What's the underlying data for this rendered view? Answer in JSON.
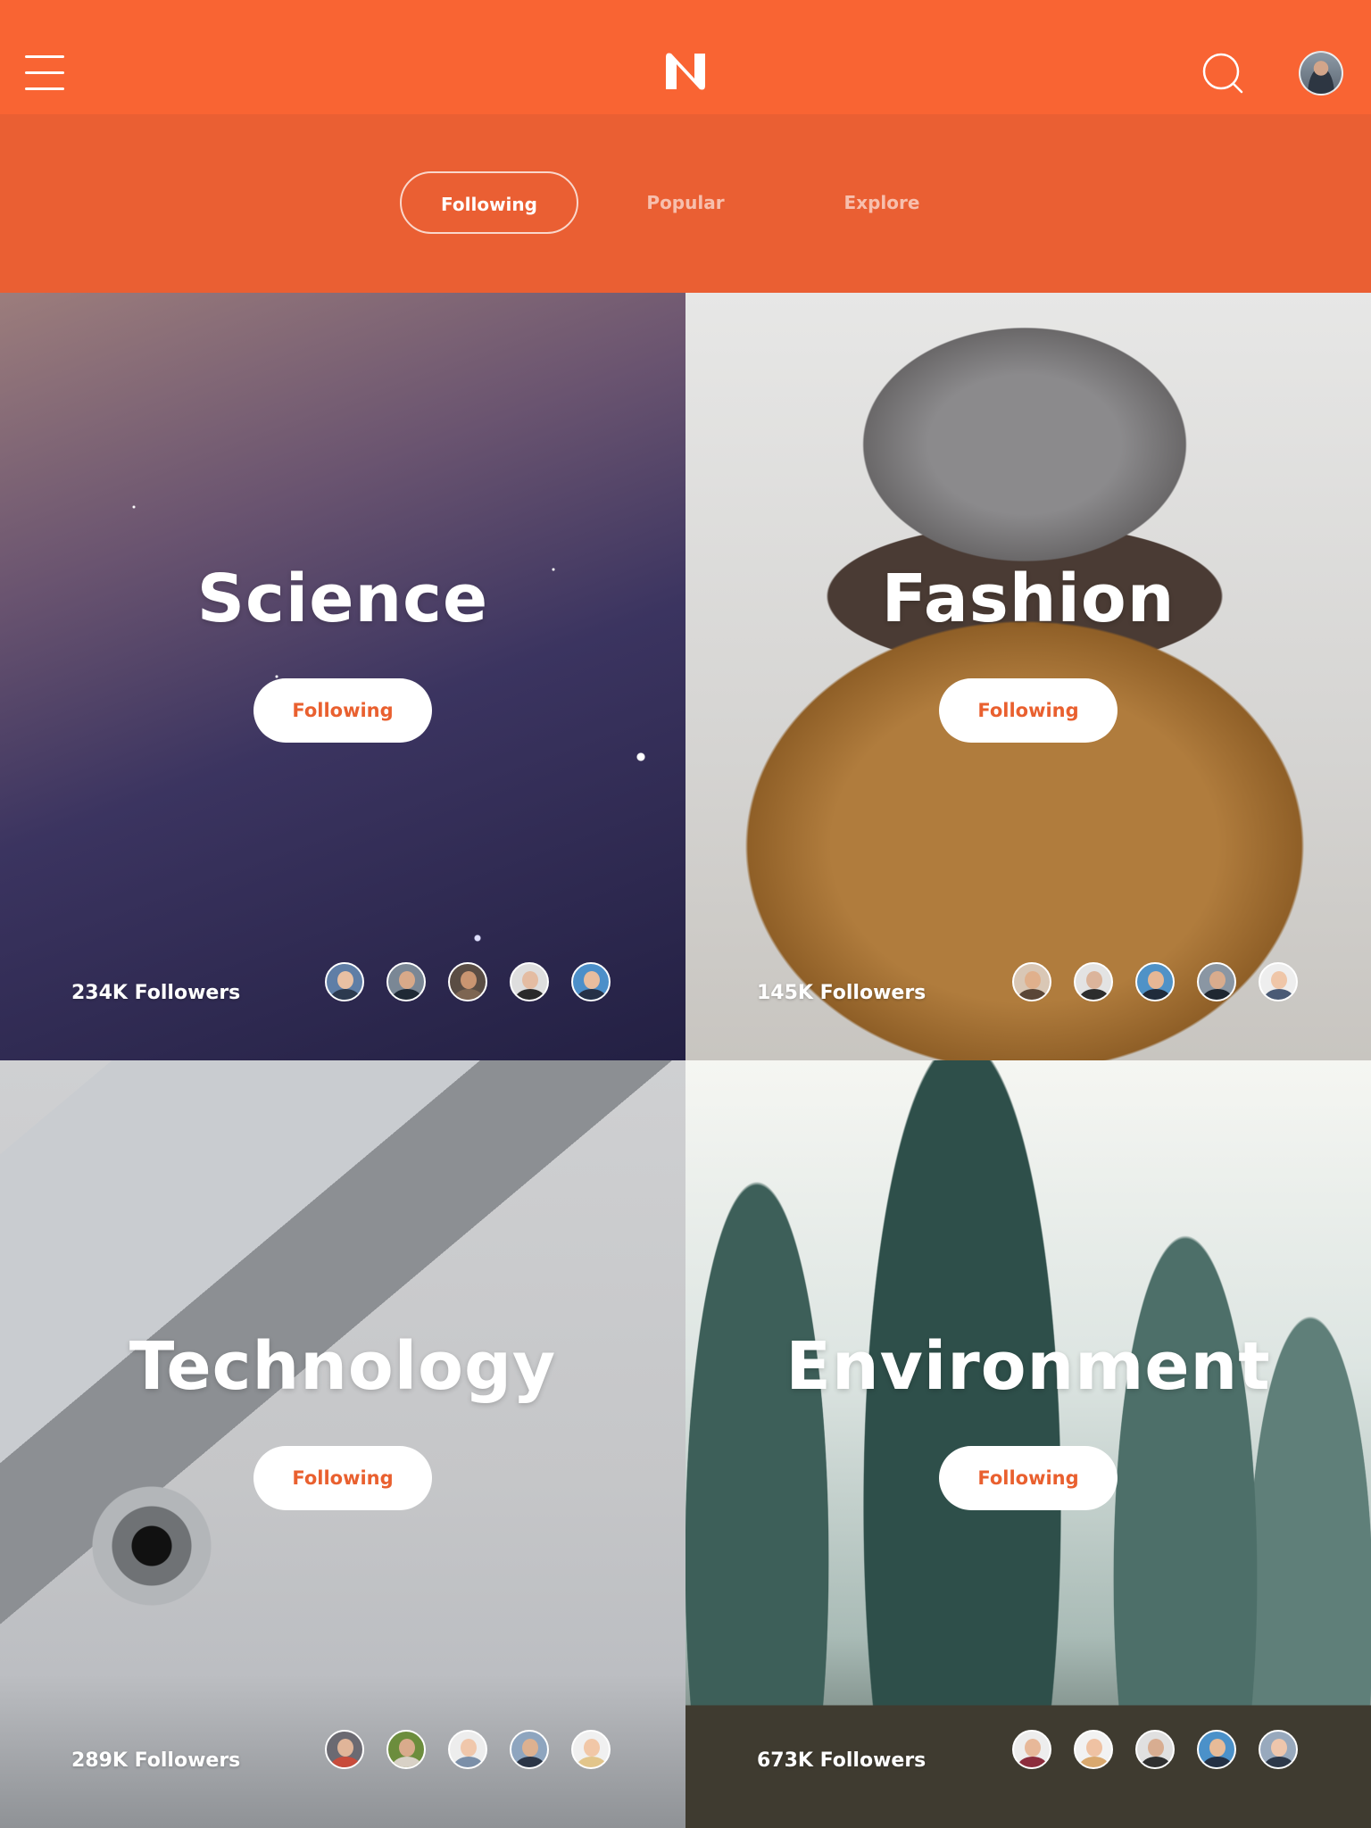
{
  "header": {
    "logo_letter": "N",
    "menu_icon": "hamburger-menu-icon",
    "search_icon": "search-icon",
    "avatar": "profile-avatar"
  },
  "tabs": [
    {
      "label": "Following",
      "active": true
    },
    {
      "label": "Popular",
      "active": false
    },
    {
      "label": "Explore",
      "active": false
    }
  ],
  "topics": [
    {
      "title": "Science",
      "button": "Following",
      "followers": "234K Followers"
    },
    {
      "title": "Fashion",
      "button": "Following",
      "followers": "145K Followers"
    },
    {
      "title": "Technology",
      "button": "Following",
      "followers": "289K Followers"
    },
    {
      "title": "Environment",
      "button": "Following",
      "followers": "673K Followers"
    }
  ],
  "colors": {
    "brand_orange": "#f96433",
    "tab_band": "#ea5f33",
    "button_text": "#e9602f"
  }
}
